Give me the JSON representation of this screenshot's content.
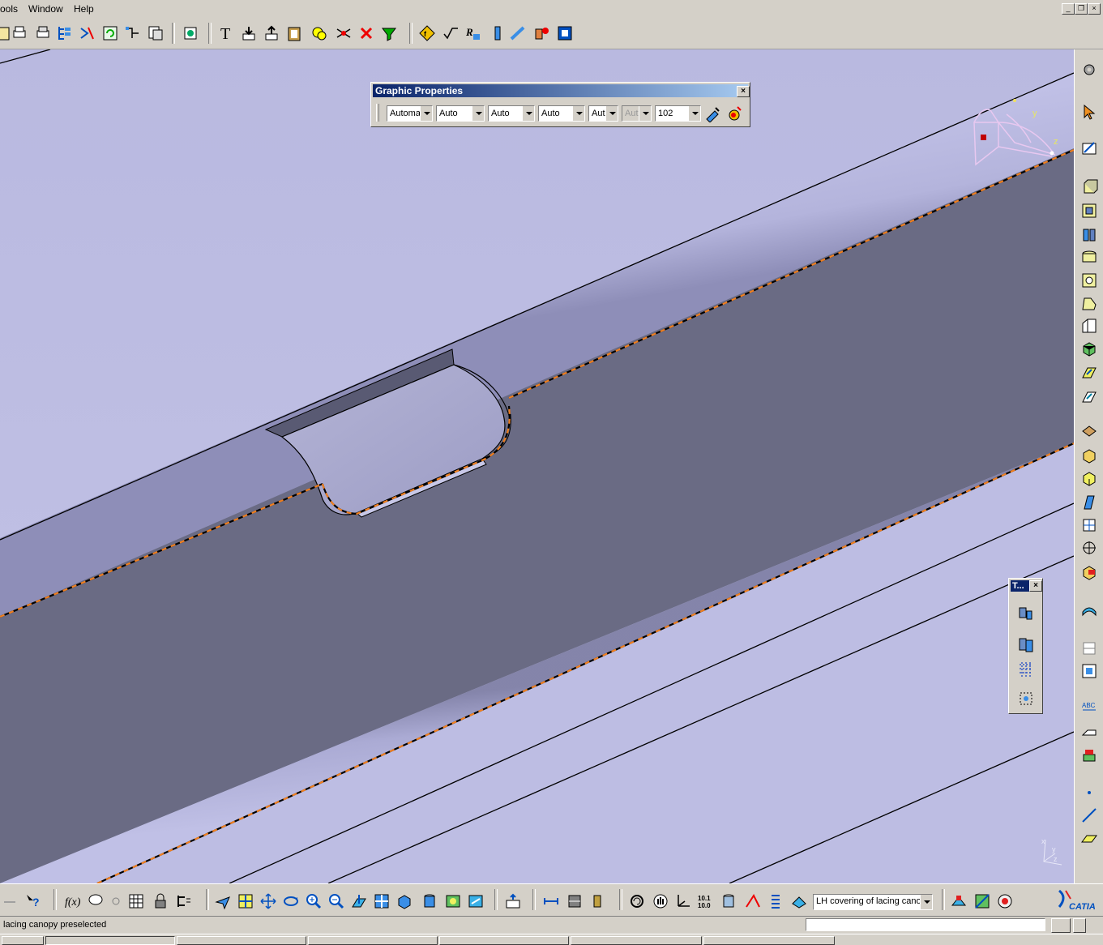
{
  "menu": {
    "items": [
      "ools",
      "Window",
      "Help"
    ]
  },
  "graphic_properties": {
    "title": "Graphic Properties",
    "close_label": "×",
    "fields": [
      {
        "value": "Automa",
        "disabled": false
      },
      {
        "value": "Auto",
        "disabled": false
      },
      {
        "value": "Auto",
        "disabled": false
      },
      {
        "value": "Auto",
        "disabled": false
      },
      {
        "value": "Aut",
        "disabled": false
      },
      {
        "value": "Aut",
        "disabled": true
      },
      {
        "value": "102",
        "disabled": false
      }
    ]
  },
  "small_toolbar": {
    "title": "T...",
    "close_label": "×"
  },
  "bottom": {
    "selector_value": "LH covering of lacing canop"
  },
  "status": {
    "text": "lacing canopy preselected",
    "command_input": ""
  },
  "compass": {
    "y_label": "y",
    "z_label": "z"
  },
  "axis_triad": {
    "x_label": "x",
    "y_label": "y",
    "z_label": "z"
  },
  "colors": {
    "background": "#bfbfe3",
    "part_dark": "#6a6b84",
    "preselect_highlight": "#f07f1f",
    "title_bar": "#0a246a",
    "toolbar": "#d4d0c8"
  },
  "branding": {
    "logo_text": "CATIA"
  }
}
